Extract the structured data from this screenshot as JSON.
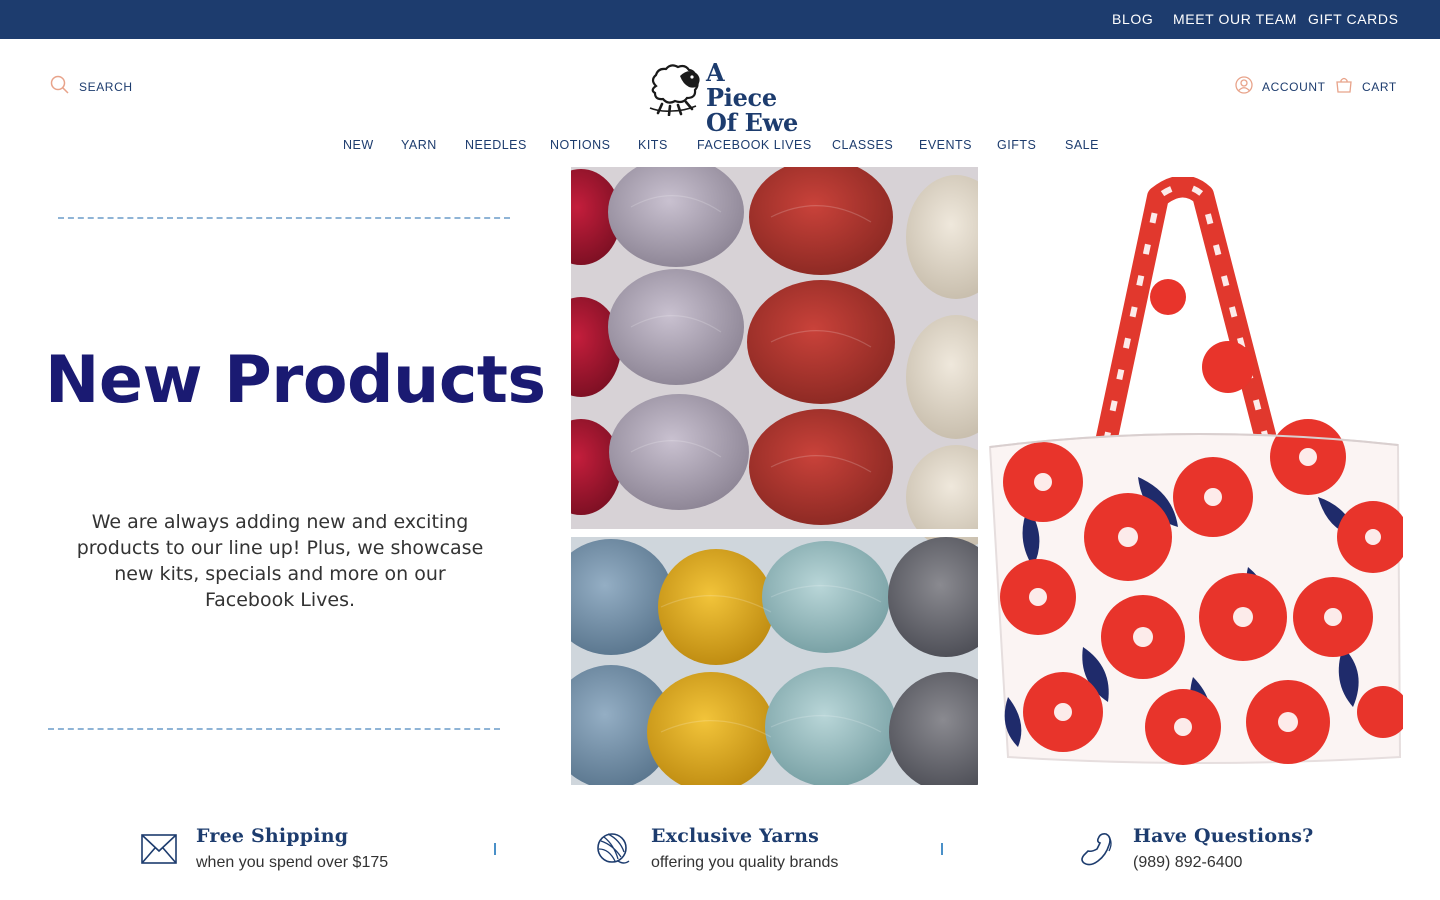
{
  "topbar": {
    "links": [
      "BLOG",
      "MEET OUR TEAM",
      "GIFT CARDS"
    ]
  },
  "header": {
    "search_label": "SEARCH",
    "logo_line1": "A Piece",
    "logo_line2": "Of Ewe",
    "account_label": "ACCOUNT",
    "cart_label": "CART"
  },
  "nav": {
    "items": [
      "NEW",
      "YARN",
      "NEEDLES",
      "NOTIONS",
      "KITS",
      "FACEBOOK LIVES",
      "CLASSES",
      "EVENTS",
      "GIFTS",
      "SALE"
    ]
  },
  "hero": {
    "title": "New Products",
    "copy": "We are always adding new and exciting products to our line up! Plus, we showcase new kits, specials and more on our Facebook Lives."
  },
  "benefits": [
    {
      "title": "Free Shipping",
      "subtitle": "when you spend over $175",
      "icon": "envelope-icon"
    },
    {
      "title": "Exclusive Yarns",
      "subtitle": "offering you quality brands",
      "icon": "yarn-ball-icon"
    },
    {
      "title": "Have Questions?",
      "subtitle": "(989) 892-6400",
      "icon": "phone-icon"
    }
  ],
  "colors": {
    "brand_navy": "#1d3c6e",
    "hero_title": "#1a1a72",
    "accent_dash": "#8fb4d6",
    "icon_accent": "#e8a38a"
  }
}
